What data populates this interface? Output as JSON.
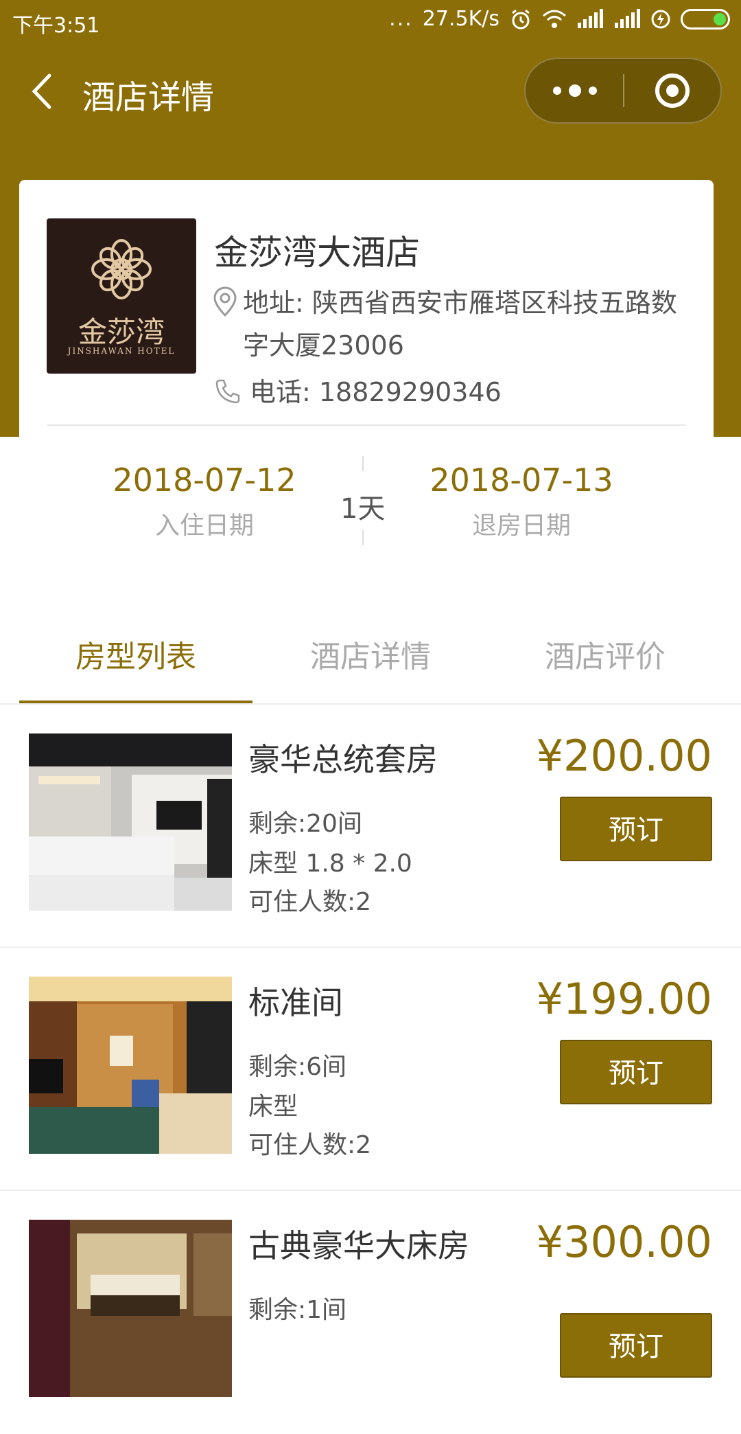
{
  "status_bar": {
    "time": "下午3:51",
    "dots": "...",
    "net_speed": "27.5K/s"
  },
  "nav": {
    "title": "酒店详情"
  },
  "hotel": {
    "logo_text": "金莎湾",
    "logo_subtext": "JINSHAWAN HOTEL",
    "name": "金莎湾大酒店",
    "address_label": "地址:",
    "address": "地址: 陕西省西安市雁塔区科技五路数字大厦23006",
    "phone": "电话: 18829290346"
  },
  "dates": {
    "checkin": "2018-07-12",
    "checkin_label": "入住日期",
    "nights": "1天",
    "checkout": "2018-07-13",
    "checkout_label": "退房日期"
  },
  "tabs": [
    {
      "label": "房型列表",
      "active": true
    },
    {
      "label": "酒店详情",
      "active": false
    },
    {
      "label": "酒店评价",
      "active": false
    }
  ],
  "rooms": [
    {
      "name": "豪华总统套房",
      "remaining": "剩余:20间",
      "bed": "床型 1.8 * 2.0",
      "capacity": "可住人数:2",
      "price": "¥200.00",
      "button": "预订"
    },
    {
      "name": "标准间",
      "remaining": "剩余:6间",
      "bed": "床型",
      "capacity": "可住人数:2",
      "price": "¥199.00",
      "button": "预订"
    },
    {
      "name": "古典豪华大床房",
      "remaining": "剩余:1间",
      "price": "¥300.00",
      "button": "预订"
    }
  ],
  "colors": {
    "primary": "#8c6e08",
    "text": "#333333",
    "muted": "#aaaaaa"
  }
}
